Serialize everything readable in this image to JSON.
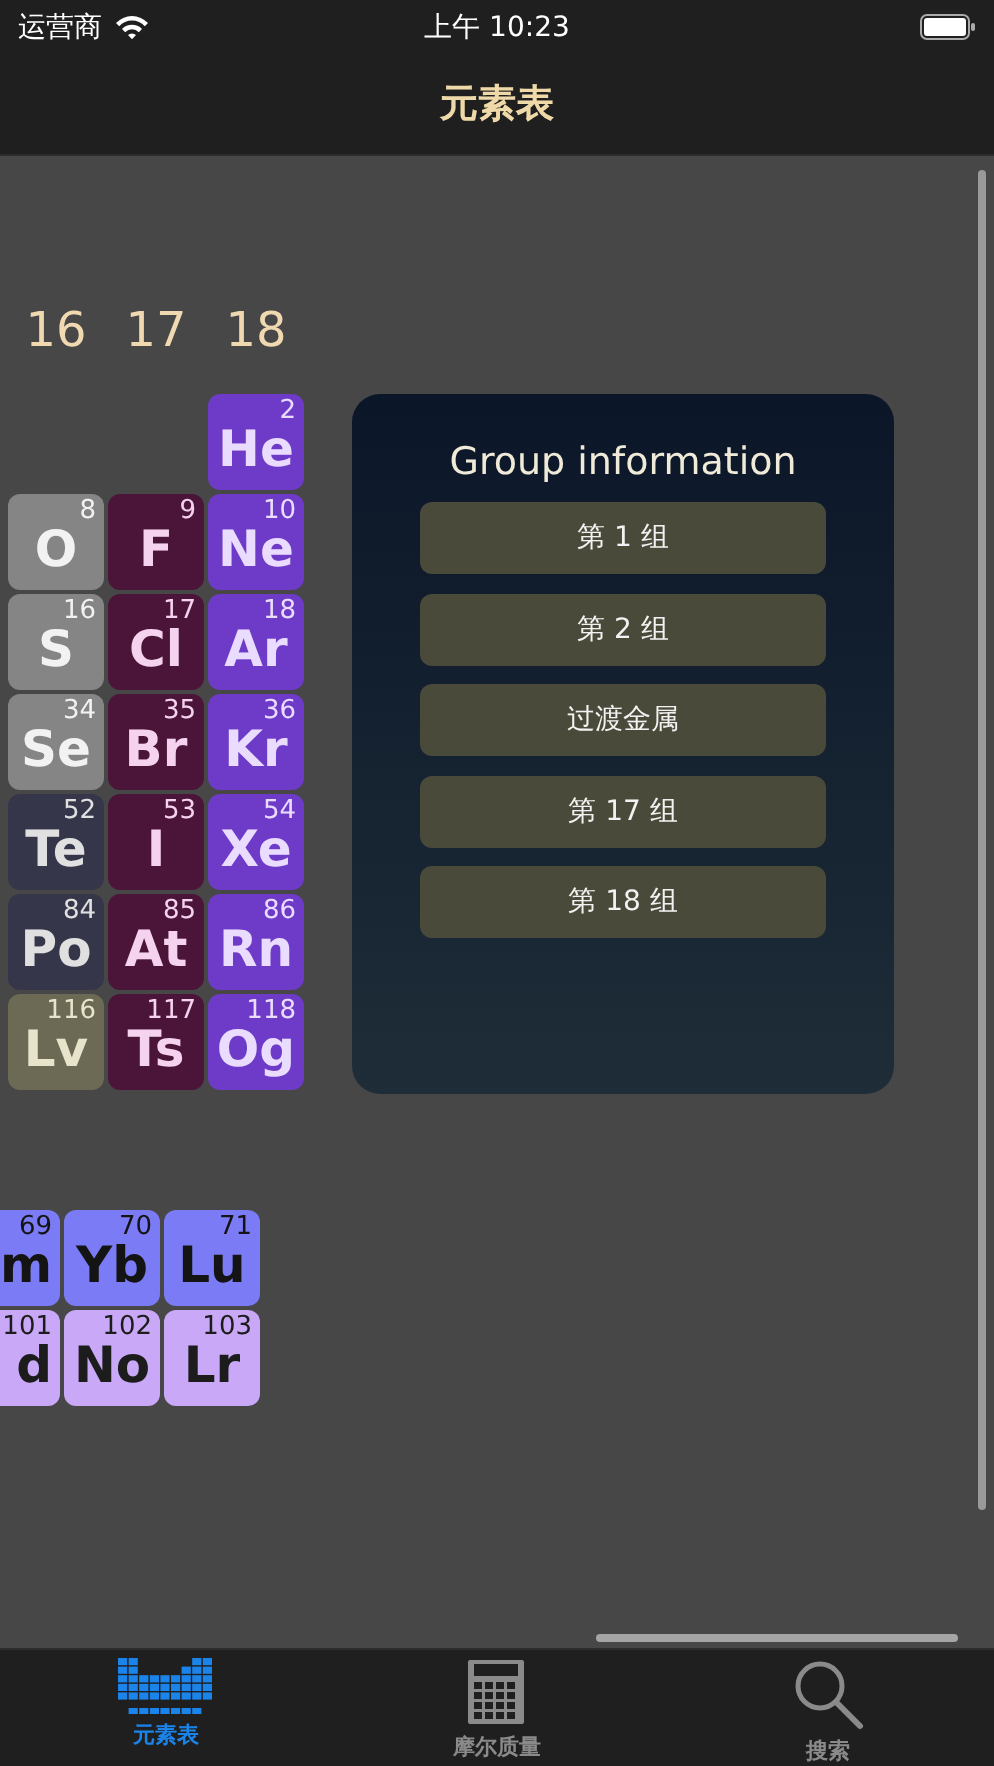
{
  "status_bar": {
    "carrier": "运营商",
    "time": "上午 10:23"
  },
  "nav_bar": {
    "title": "元素表"
  },
  "group_headers": [
    "16",
    "17",
    "18"
  ],
  "table_rows": [
    [
      {
        "kind": "empty"
      },
      {
        "kind": "empty"
      },
      {
        "kind": "noble",
        "symbol": "He",
        "number": "2",
        "color": "#6e3bc8"
      }
    ],
    [
      {
        "kind": "nonmetal",
        "symbol": "O",
        "number": "8",
        "color": "#858585"
      },
      {
        "kind": "halogen",
        "symbol": "F",
        "number": "9",
        "color": "#4a1538"
      },
      {
        "kind": "noble",
        "symbol": "Ne",
        "number": "10",
        "color": "#6e3bc8"
      }
    ],
    [
      {
        "kind": "nonmetal",
        "symbol": "S",
        "number": "16",
        "color": "#858585"
      },
      {
        "kind": "halogen",
        "symbol": "Cl",
        "number": "17",
        "color": "#4a1538"
      },
      {
        "kind": "noble",
        "symbol": "Ar",
        "number": "18",
        "color": "#6e3bc8"
      }
    ],
    [
      {
        "kind": "nonmetal",
        "symbol": "Se",
        "number": "34",
        "color": "#858585"
      },
      {
        "kind": "halogen",
        "symbol": "Br",
        "number": "35",
        "color": "#4a1538"
      },
      {
        "kind": "noble",
        "symbol": "Kr",
        "number": "36",
        "color": "#6e3bc8"
      }
    ],
    [
      {
        "kind": "metalloid",
        "symbol": "Te",
        "number": "52",
        "color": "#36364a"
      },
      {
        "kind": "halogen",
        "symbol": "I",
        "number": "53",
        "color": "#4a1538"
      },
      {
        "kind": "noble",
        "symbol": "Xe",
        "number": "54",
        "color": "#6e3bc8"
      }
    ],
    [
      {
        "kind": "metalloid",
        "symbol": "Po",
        "number": "84",
        "color": "#36364a"
      },
      {
        "kind": "halogen",
        "symbol": "At",
        "number": "85",
        "color": "#4a1538"
      },
      {
        "kind": "noble",
        "symbol": "Rn",
        "number": "86",
        "color": "#6e3bc8"
      }
    ],
    [
      {
        "kind": "unknown",
        "symbol": "Lv",
        "number": "116",
        "color": "#6c6a55"
      },
      {
        "kind": "halogen",
        "symbol": "Ts",
        "number": "117",
        "color": "#4a1538"
      },
      {
        "kind": "noble",
        "symbol": "Og",
        "number": "118",
        "color": "#6e3bc8"
      }
    ]
  ],
  "group_panel": {
    "title": "Group information",
    "buttons": [
      "第 1 组",
      "第 2 组",
      "过渡金属",
      "第 17 组",
      "第 18 组"
    ]
  },
  "f_block_rows": [
    [
      {
        "kind": "lanthanide",
        "symbol": "m",
        "number": "69",
        "color": "#7b7bf5",
        "clipped": true
      },
      {
        "kind": "lanthanide",
        "symbol": "Yb",
        "number": "70",
        "color": "#7b7bf5",
        "clipped": false
      },
      {
        "kind": "lanthanide",
        "symbol": "Lu",
        "number": "71",
        "color": "#7b7bf5",
        "clipped": false
      }
    ],
    [
      {
        "kind": "actinide",
        "symbol": "d",
        "number": "101",
        "color": "#c9a8f7",
        "clipped": true
      },
      {
        "kind": "actinide",
        "symbol": "No",
        "number": "102",
        "color": "#c9a8f7",
        "clipped": false
      },
      {
        "kind": "actinide",
        "symbol": "Lr",
        "number": "103",
        "color": "#c9a8f7",
        "clipped": false
      }
    ]
  ],
  "tab_bar": [
    {
      "kind": "table",
      "label": "元素表",
      "selected": true
    },
    {
      "kind": "calculator",
      "label": "摩尔质量",
      "selected": false
    },
    {
      "kind": "search",
      "label": "搜索",
      "selected": false
    }
  ]
}
